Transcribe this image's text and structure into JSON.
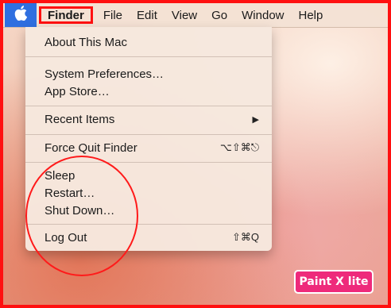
{
  "menubar": {
    "apple_glyph": "",
    "items": [
      "Finder",
      "File",
      "Edit",
      "View",
      "Go",
      "Window",
      "Help"
    ]
  },
  "apple_menu": {
    "about": "About This Mac",
    "system_prefs": "System Preferences…",
    "app_store": "App Store…",
    "recent_items": "Recent Items",
    "recent_arrow": "▶",
    "force_quit": "Force Quit Finder",
    "force_quit_shortcut": "⌥⇧⌘⎋",
    "sleep": "Sleep",
    "restart": "Restart…",
    "shut_down": "Shut Down…",
    "log_out": "Log Out",
    "log_out_shortcut": "⇧⌘Q"
  },
  "watermark": "Paint X lite",
  "colors": {
    "highlight_red": "#ff1010",
    "apple_blue": "#2f6fe0",
    "badge_pink": "#ee2a7b"
  }
}
